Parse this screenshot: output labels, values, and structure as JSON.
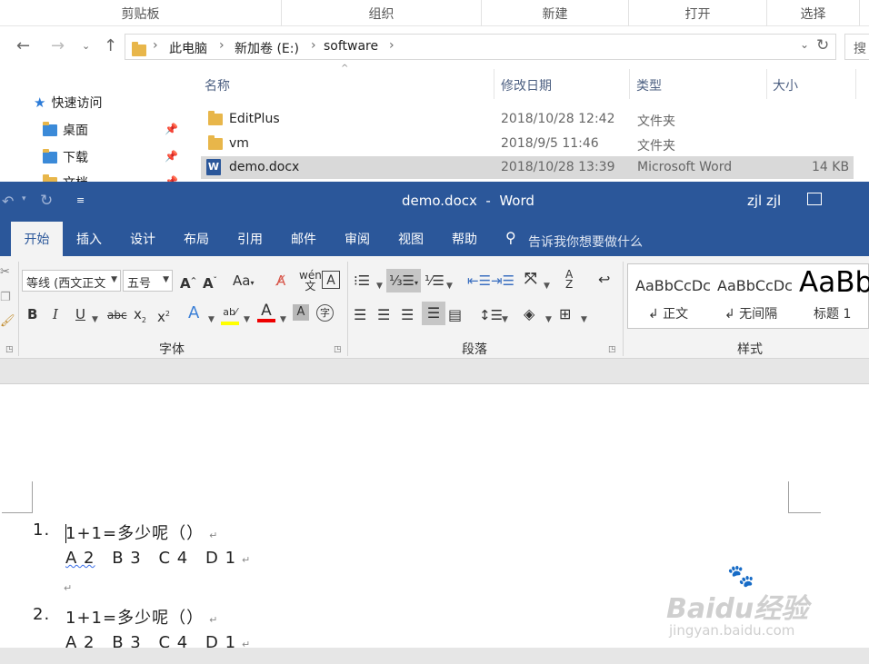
{
  "explorer": {
    "ribbon_groups": [
      "剪贴板",
      "组织",
      "新建",
      "打开",
      "选择"
    ],
    "breadcrumb": [
      "此电脑",
      "新加卷 (E:)",
      "software"
    ],
    "search_placeholder": "搜",
    "nav": {
      "quick_access": "快速访问",
      "items": [
        "桌面",
        "下载",
        "文档"
      ]
    },
    "columns": [
      "名称",
      "修改日期",
      "类型",
      "大小"
    ],
    "files": [
      {
        "name": "EditPlus",
        "date": "2018/10/28 12:42",
        "type": "文件夹",
        "size": ""
      },
      {
        "name": "vm",
        "date": "2018/9/5 11:46",
        "type": "文件夹",
        "size": ""
      },
      {
        "name": "demo.docx",
        "date": "2018/10/28 13:39",
        "type": "Microsoft Word",
        "size": "14 KB"
      }
    ]
  },
  "word": {
    "title": "demo.docx  -  Word",
    "user": "zjl zjl",
    "tabs": [
      "开始",
      "插入",
      "设计",
      "布局",
      "引用",
      "邮件",
      "审阅",
      "视图",
      "帮助"
    ],
    "tell_me": "告诉我你想要做什么",
    "font_name": "等线 (西文正文",
    "font_size": "五号",
    "group_labels": {
      "font": "字体",
      "paragraph": "段落",
      "styles": "样式"
    },
    "styles": [
      {
        "preview": "AaBbCcDc",
        "name": "↲ 正文"
      },
      {
        "preview": "AaBbCcDc",
        "name": "↲ 无间隔"
      },
      {
        "preview": "AaBb",
        "name": "标题 1"
      }
    ],
    "document": {
      "q1_num": "1.",
      "q1": "1+1=多少呢（）",
      "q1_options": [
        "A 2",
        "B 3",
        "C 4",
        "D 1"
      ],
      "q2_num": "2.",
      "q2": "1+1=多少呢（）",
      "q2_options": [
        "A 2",
        "B 3",
        "C 4",
        "D 1"
      ],
      "paragraph_mark": "↵"
    }
  },
  "watermark": {
    "logo": "Baidu经验",
    "url": "jingyan.baidu.com"
  },
  "colors": {
    "word_blue": "#2b579a",
    "ribbon_bg": "#f3f3f3",
    "selected_row": "#d9d9d9"
  }
}
